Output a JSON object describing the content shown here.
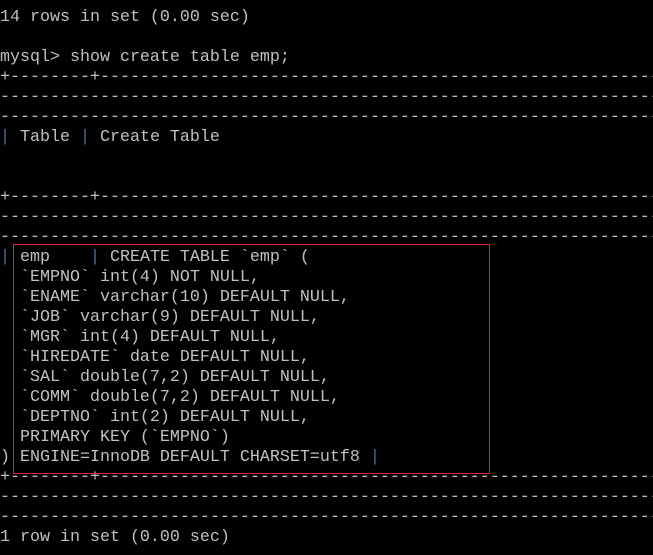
{
  "terminal": {
    "highlight_color": "#e0262c",
    "lines": [
      {
        "kind": "text",
        "text": "14 rows in set (0.00 sec)"
      },
      {
        "kind": "text",
        "text": ""
      },
      {
        "kind": "text",
        "text": "mysql> show create table emp;"
      },
      {
        "kind": "border",
        "text": "+--------+---------------------------------------------------------"
      },
      {
        "kind": "dash",
        "text": "------------------------------------------------------------------"
      },
      {
        "kind": "dash",
        "text": "------------------------------------------------------------------"
      },
      {
        "kind": "row",
        "cells": [
          "",
          " Table ",
          " Create Table"
        ]
      },
      {
        "kind": "text",
        "text": ""
      },
      {
        "kind": "text",
        "text": ""
      },
      {
        "kind": "border",
        "text": "+--------+---------------------------------------------------------"
      },
      {
        "kind": "dash",
        "text": "------------------------------------------------------------------"
      },
      {
        "kind": "dash",
        "text": "------------------------------------------------------------------"
      },
      {
        "kind": "row",
        "cells": [
          "",
          " emp    ",
          " CREATE TABLE `emp` ("
        ]
      },
      {
        "kind": "text",
        "text": "  `EMPNO` int(4) NOT NULL,"
      },
      {
        "kind": "text",
        "text": "  `ENAME` varchar(10) DEFAULT NULL,"
      },
      {
        "kind": "text",
        "text": "  `JOB` varchar(9) DEFAULT NULL,"
      },
      {
        "kind": "text",
        "text": "  `MGR` int(4) DEFAULT NULL,"
      },
      {
        "kind": "text",
        "text": "  `HIREDATE` date DEFAULT NULL,"
      },
      {
        "kind": "text",
        "text": "  `SAL` double(7,2) DEFAULT NULL,"
      },
      {
        "kind": "text",
        "text": "  `COMM` double(7,2) DEFAULT NULL,"
      },
      {
        "kind": "text",
        "text": "  `DEPTNO` int(2) DEFAULT NULL,"
      },
      {
        "kind": "text",
        "text": "  PRIMARY KEY (`EMPNO`)"
      },
      {
        "kind": "endrow",
        "text": ") ENGINE=InnoDB DEFAULT CHARSET=utf8 "
      },
      {
        "kind": "border",
        "text": "+--------+---------------------------------------------------------"
      },
      {
        "kind": "dash",
        "text": "------------------------------------------------------------------"
      },
      {
        "kind": "dash",
        "text": "------------------------------------------------------------------"
      },
      {
        "kind": "text",
        "text": "1 row in set (0.00 sec)"
      }
    ]
  }
}
